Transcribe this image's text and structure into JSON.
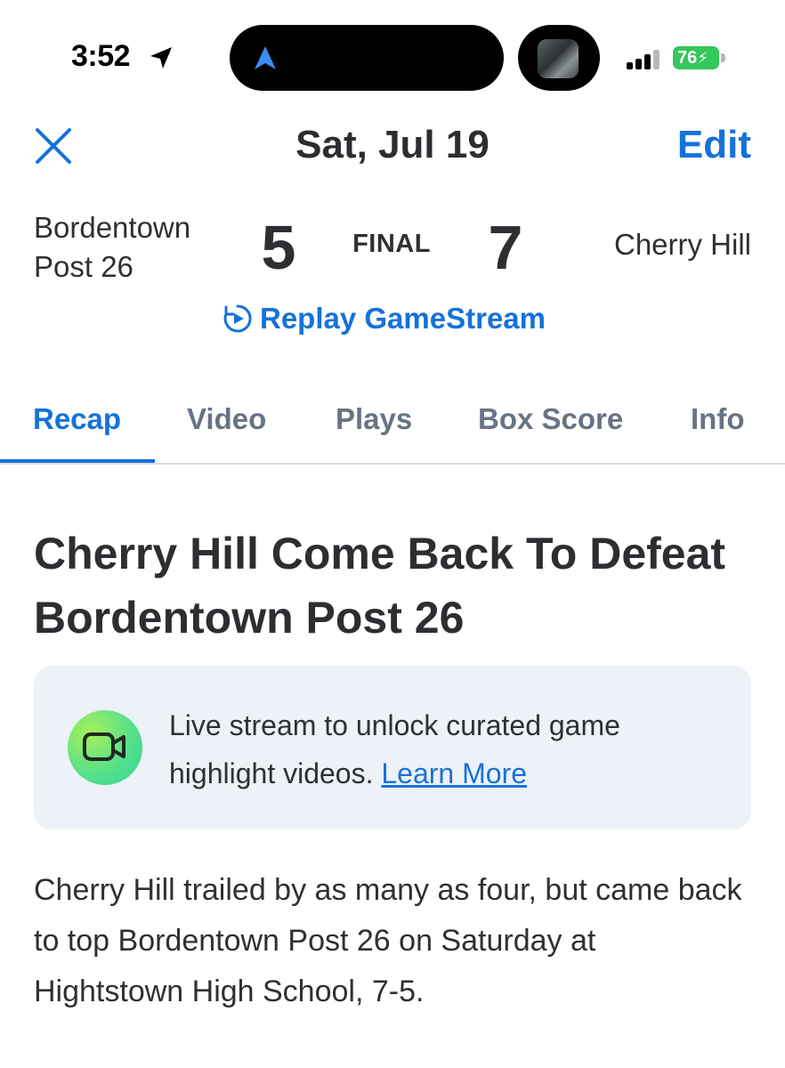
{
  "status_bar": {
    "time": "3:52",
    "battery": "76",
    "icons": [
      "location-arrow-icon",
      "navigation-icon",
      "signal-icon",
      "battery-icon"
    ]
  },
  "header": {
    "date": "Sat, Jul 19",
    "edit_label": "Edit"
  },
  "scoreboard": {
    "away_team": "Bordentown Post 26",
    "away_score": "5",
    "status": "FINAL",
    "home_score": "7",
    "home_team": "Cherry Hill",
    "replay_label": "Replay GameStream"
  },
  "tabs": [
    {
      "label": "Recap",
      "active": true
    },
    {
      "label": "Video",
      "active": false
    },
    {
      "label": "Plays",
      "active": false
    },
    {
      "label": "Box Score",
      "active": false
    },
    {
      "label": "Info",
      "active": false
    }
  ],
  "article": {
    "headline": "Cherry Hill Come Back To Defeat Bordentown Post 26",
    "promo_text": "Live stream to unlock curated game highlight videos.",
    "promo_link": "Learn More",
    "body": "Cherry Hill trailed by as many as four, but came back to top Bordentown Post 26 on Saturday at Hightstown High School, 7-5."
  },
  "colors": {
    "accent": "#1572d9",
    "text": "#2f3034",
    "tab_inactive": "#687384",
    "promo_bg": "#edf1f8",
    "battery": "#34c759"
  }
}
